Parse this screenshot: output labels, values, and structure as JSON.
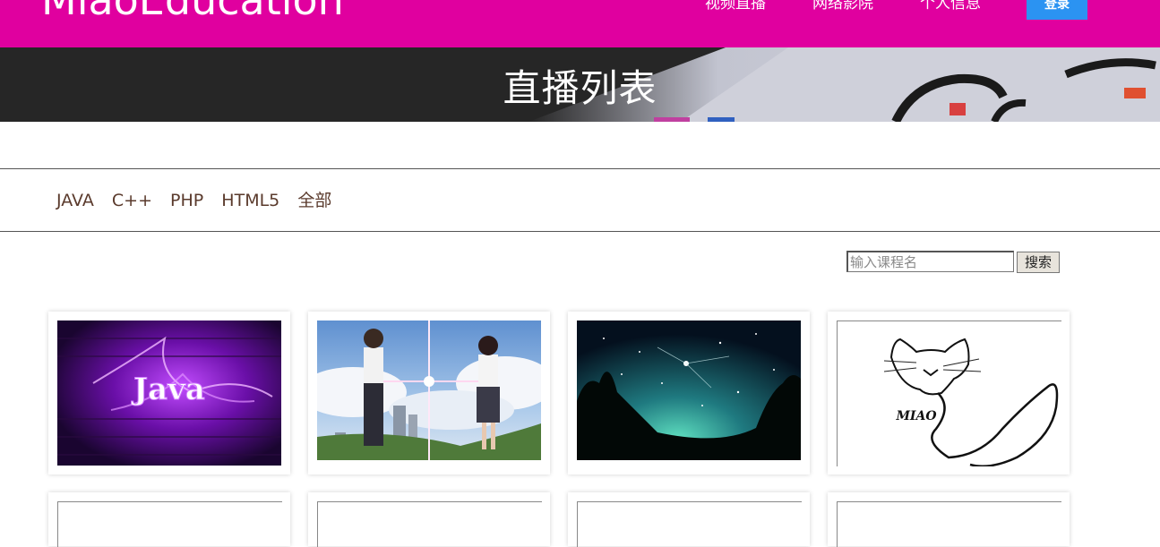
{
  "header": {
    "brand": "MiaoEducation",
    "nav": [
      {
        "label": "视频直播"
      },
      {
        "label": "网络影院"
      },
      {
        "label": "个人信息"
      }
    ],
    "login_label": "登录",
    "colors": {
      "bar": "#e0009f",
      "login": "#2b93f2"
    }
  },
  "banner": {
    "title": "直播列表"
  },
  "categories": [
    {
      "label": "JAVA"
    },
    {
      "label": "C++"
    },
    {
      "label": "PHP"
    },
    {
      "label": "HTML5"
    },
    {
      "label": "全部"
    }
  ],
  "search": {
    "placeholder": "输入课程名",
    "value": "",
    "button_label": "搜索"
  },
  "courses": [
    {
      "image": "java-purple-graphic",
      "logo_text": "Java"
    },
    {
      "image": "anime-couple-sky"
    },
    {
      "image": "starry-night-sky"
    },
    {
      "image": "miao-cat-logo",
      "logo_text": "MIAO"
    },
    {
      "image": "image-placeholder"
    },
    {
      "image": "image-placeholder"
    },
    {
      "image": "image-placeholder"
    },
    {
      "image": "image-placeholder"
    }
  ]
}
